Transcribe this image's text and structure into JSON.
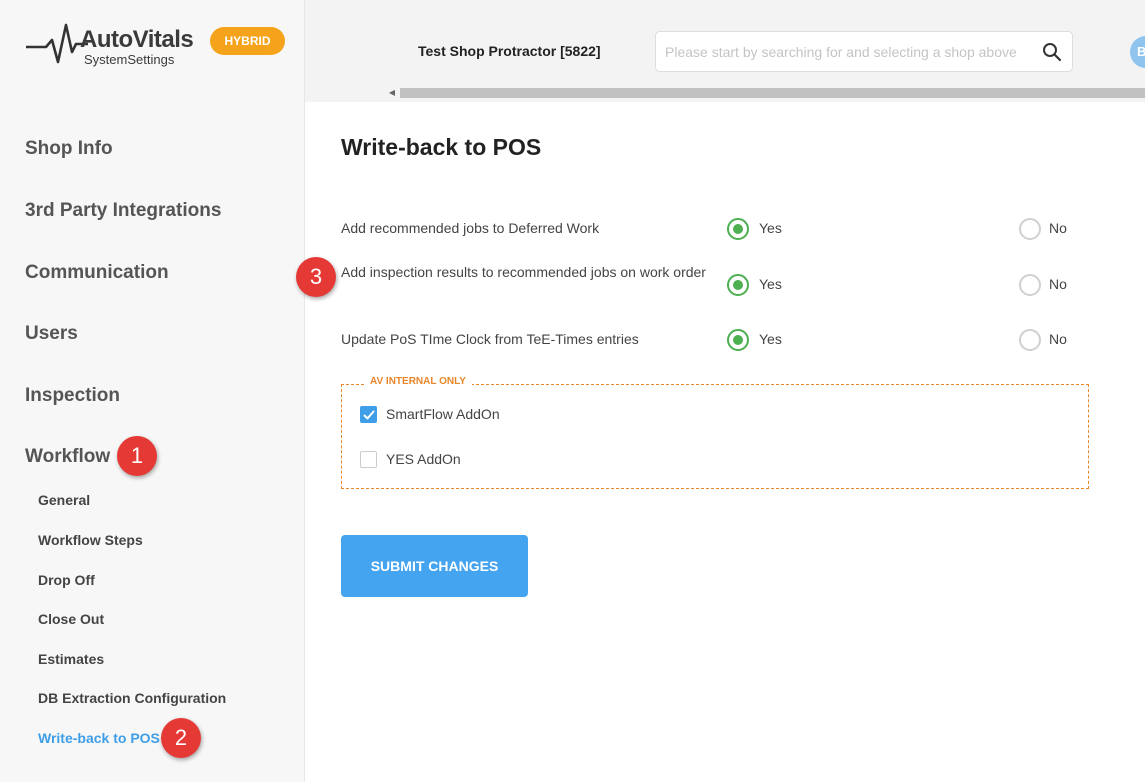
{
  "app": {
    "brand": "AutoVitals",
    "subtitle": "SystemSettings",
    "mode_badge": "HYBRID"
  },
  "sidebar": {
    "items": [
      {
        "label": "Shop Info"
      },
      {
        "label": "3rd Party Integrations"
      },
      {
        "label": "Communication"
      },
      {
        "label": "Users"
      },
      {
        "label": "Inspection"
      },
      {
        "label": "Workflow"
      }
    ],
    "workflow_subitems": [
      {
        "label": "General"
      },
      {
        "label": "Workflow Steps"
      },
      {
        "label": "Drop Off"
      },
      {
        "label": "Close Out"
      },
      {
        "label": "Estimates"
      },
      {
        "label": "DB Extraction Configuration"
      },
      {
        "label": "Write-back to POS",
        "active": true
      }
    ]
  },
  "header": {
    "shop_name": "Test Shop Protractor [5822]",
    "search_placeholder": "Please start by searching for and selecting a shop above",
    "avatar_initial": "B"
  },
  "main": {
    "title": "Write-back to POS",
    "options": [
      {
        "label": "Add recommended jobs to Deferred Work",
        "yes_label": "Yes",
        "no_label": "No",
        "selected": "Yes"
      },
      {
        "label": "Add inspection results to recommended jobs on work order",
        "yes_label": "Yes",
        "no_label": "No",
        "selected": "Yes"
      },
      {
        "label": "Update PoS TIme Clock from TeE-Times entries",
        "yes_label": "Yes",
        "no_label": "No",
        "selected": "Yes"
      }
    ],
    "internal": {
      "legend": "AV INTERNAL ONLY",
      "addons": [
        {
          "label": "SmartFlow AddOn",
          "checked": true
        },
        {
          "label": "YES AddOn",
          "checked": false
        }
      ]
    },
    "submit_label": "SUBMIT CHANGES"
  },
  "annotations": [
    "1",
    "2",
    "3"
  ],
  "colors": {
    "accent_blue": "#45a4f0",
    "radio_green": "#4caf50",
    "badge_orange": "#f5a31a",
    "annotation_red": "#e53935",
    "internal_orange": "#e8862a"
  }
}
